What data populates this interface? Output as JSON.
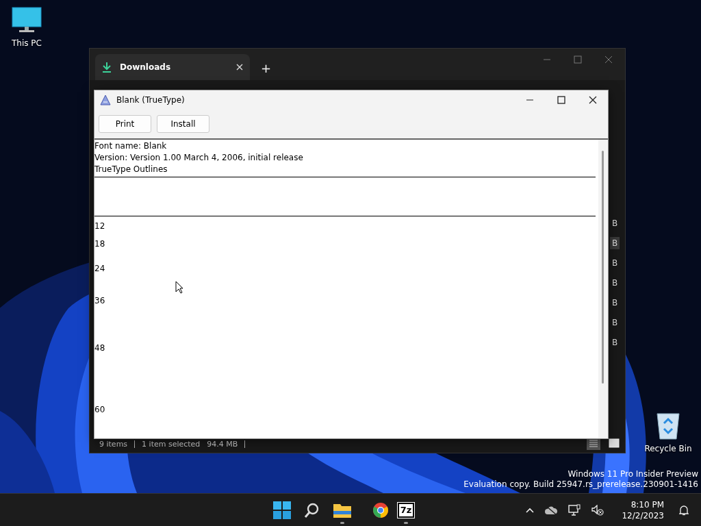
{
  "desktop_icons": [
    {
      "label": "This PC",
      "kind": "pc"
    },
    {
      "label": "Recycle Bin",
      "kind": "bin"
    }
  ],
  "explorer": {
    "tab": {
      "title": "Downloads",
      "selected": true
    },
    "new_tab": "+",
    "size_cells": [
      {
        "text": "B",
        "selected": false
      },
      {
        "text": "B",
        "selected": true
      },
      {
        "text": "B",
        "selected": false
      },
      {
        "text": "B",
        "selected": false
      },
      {
        "text": "B",
        "selected": false
      },
      {
        "text": "B",
        "selected": false
      },
      {
        "text": "B",
        "selected": false
      }
    ],
    "status_bar": {
      "item_count": "9 items",
      "selection": "1 item selected",
      "size": "94.4 MB"
    },
    "views": [
      {
        "kind": "details",
        "selected": true
      },
      {
        "kind": "tiles",
        "selected": false
      }
    ]
  },
  "font_viewer": {
    "title": "Blank (TrueType)",
    "buttons": [
      "Print",
      "Install"
    ],
    "info": [
      "Font name: Blank",
      "Version: Version 1.00 March 4, 2006, initial release",
      "TrueType Outlines"
    ],
    "sizes": [
      "12",
      "18",
      "24",
      "36",
      "48",
      "60"
    ]
  },
  "watermark": [
    "Windows 11 Pro Insider Preview",
    "Evaluation copy. Build 25947.rs_prerelease.230901-1416"
  ],
  "taskbar": {
    "apps": [
      {
        "kind": "start",
        "running": false
      },
      {
        "kind": "search",
        "running": false
      },
      {
        "kind": "explorer",
        "running": true
      },
      {
        "kind": "chrome",
        "running": false
      },
      {
        "kind": "archiver",
        "label": "7z",
        "running": true
      }
    ],
    "time": "8:10 PM",
    "date": "12/2/2023"
  }
}
